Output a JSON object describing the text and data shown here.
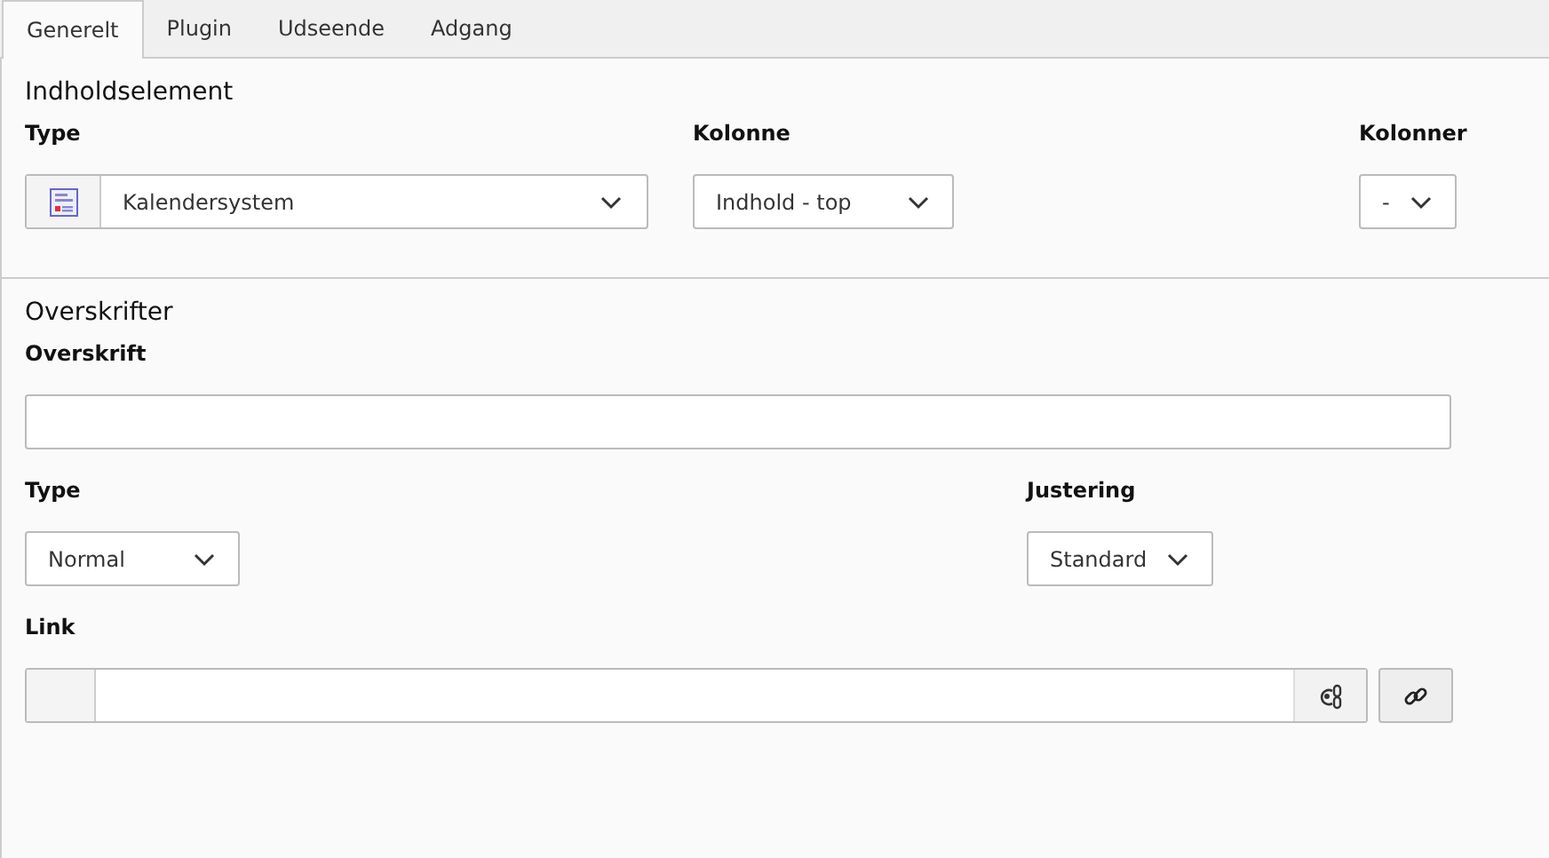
{
  "tabs": [
    {
      "label": "Generelt",
      "selected": true
    },
    {
      "label": "Plugin",
      "selected": false
    },
    {
      "label": "Udseende",
      "selected": false
    },
    {
      "label": "Adgang",
      "selected": false
    }
  ],
  "sections": [
    {
      "title": "Indholdselement",
      "rows": [
        [
          {
            "kind": "icon-select",
            "label": "Type",
            "value": "Kalendersystem"
          },
          {
            "kind": "select",
            "label": "Kolonne",
            "value": "Indhold - top"
          },
          {
            "kind": "select",
            "label": "Kolonner",
            "value": "-"
          }
        ]
      ]
    },
    {
      "title": "Overskrifter",
      "rows": [
        [
          {
            "kind": "text",
            "label": "Overskrift"
          }
        ],
        [
          {
            "kind": "select",
            "label": "Type",
            "value": "Normal"
          },
          {
            "kind": "select",
            "label": "Justering",
            "value": "Standard"
          }
        ],
        [
          {
            "kind": "link",
            "label": "Link"
          }
        ]
      ]
    }
  ]
}
